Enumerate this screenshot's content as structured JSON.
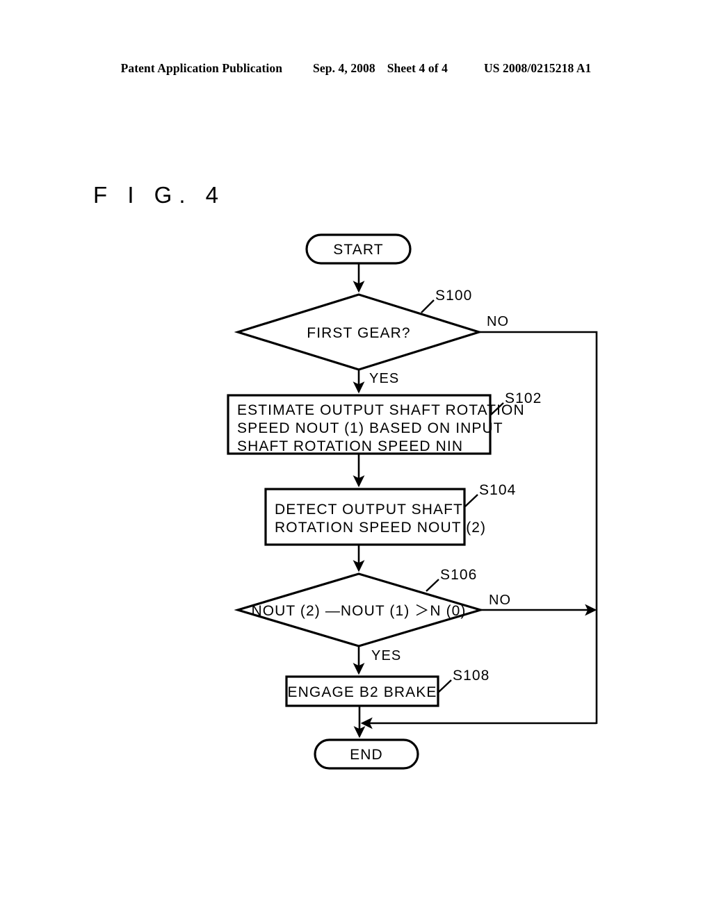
{
  "header": {
    "publication": "Patent Application Publication",
    "date": "Sep. 4, 2008",
    "sheet": "Sheet 4 of 4",
    "patent_number": "US 2008/0215218 A1"
  },
  "figure": {
    "label": "F I G. 4"
  },
  "flowchart": {
    "start_label": "START",
    "end_label": "END",
    "decision_100": {
      "step": "S100",
      "text": "FIRST GEAR?",
      "yes_label": "YES",
      "no_label": "NO"
    },
    "process_102": {
      "step": "S102",
      "lines": [
        "ESTIMATE OUTPUT SHAFT ROTATION",
        "SPEED NOUT (1) BASED ON INPUT",
        "SHAFT ROTATION SPEED NIN"
      ]
    },
    "process_104": {
      "step": "S104",
      "lines": [
        "DETECT OUTPUT SHAFT",
        "ROTATION SPEED NOUT (2)"
      ]
    },
    "decision_106": {
      "step": "S106",
      "text": "NOUT (2) —NOUT (1) ＞N (0)",
      "yes_label": "YES",
      "no_label": "NO"
    },
    "process_108": {
      "step": "S108",
      "lines": [
        "ENGAGE B2 BRAKE"
      ]
    }
  },
  "colors": {
    "ink": "#000000",
    "paper": "#ffffff"
  }
}
